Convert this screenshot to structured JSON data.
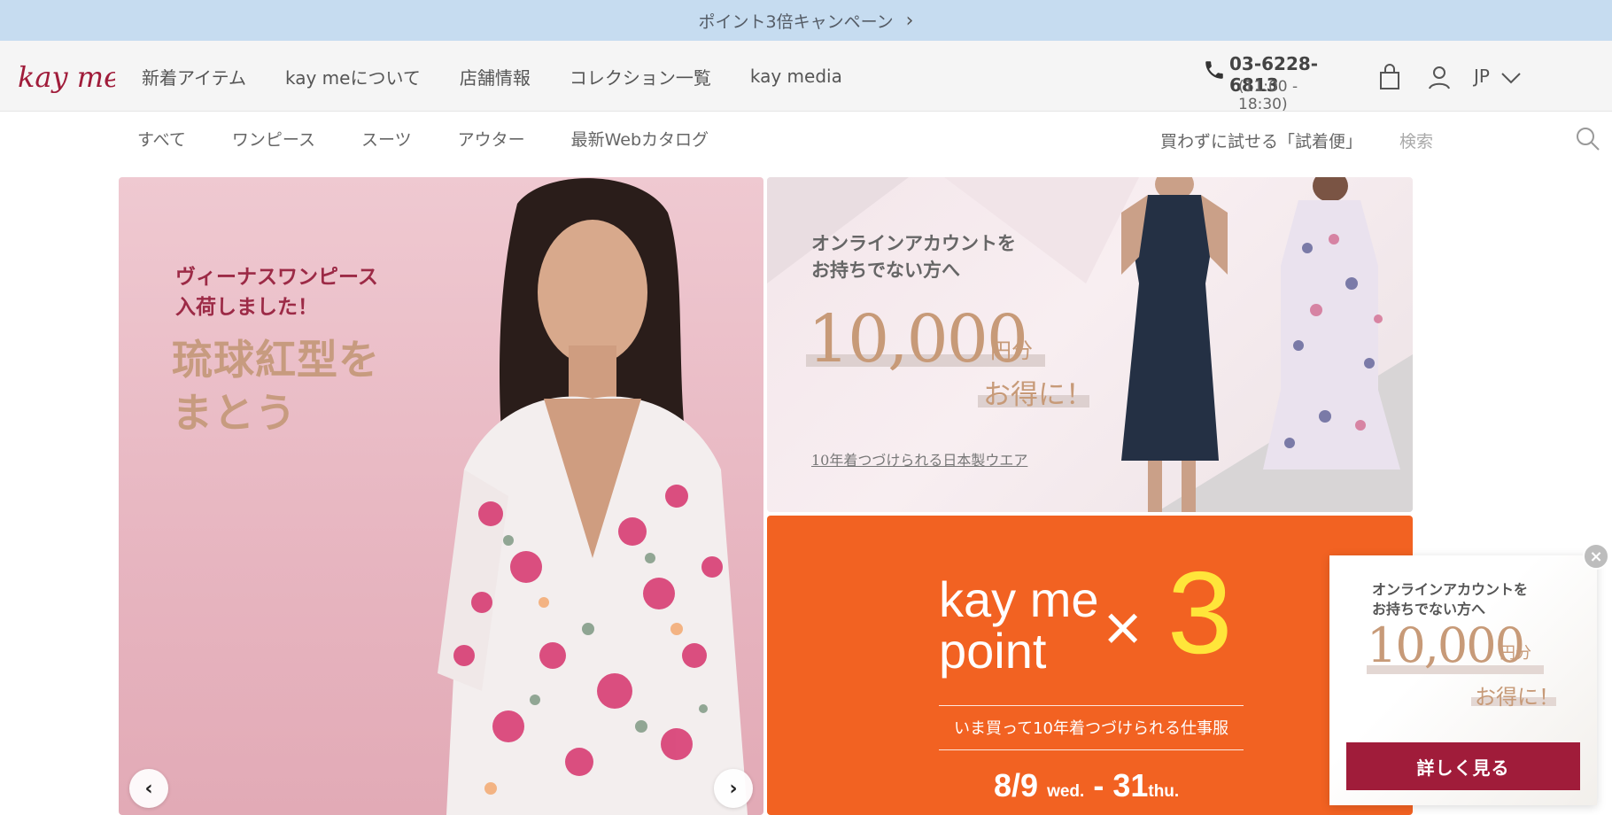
{
  "announcement": {
    "text": "ポイント3倍キャンペーン",
    "chevron": "›"
  },
  "header": {
    "logo_text": "kay me",
    "nav": [
      "新着アイテム",
      "kay meについて",
      "店舗情報",
      "コレクション一覧",
      "kay media"
    ],
    "phone": {
      "number": "03-6228-6813",
      "hours": "(11:00 - 18:30)",
      "icon": "phone-icon"
    },
    "language": "JP"
  },
  "categories": {
    "items": [
      "すべて",
      "ワンピース",
      "スーツ",
      "アウター",
      "最新Webカタログ"
    ],
    "trial_link": "買わずに試せる「試着便」",
    "search_placeholder": "検索"
  },
  "hero": {
    "subtitle_line1": "ヴィーナスワンピース",
    "subtitle_line2": "入荷しました！",
    "title_line1": "琉球紅型を",
    "title_line2": "まとう",
    "prev": "‹",
    "next": "›"
  },
  "banner_account": {
    "line1": "オンラインアカウントを",
    "line2": "お持ちでない方へ",
    "amount": "10,000",
    "unit": "円分",
    "benefit": "お得に！",
    "tagline": "10年着つづけられる日本製ウエア"
  },
  "banner_point": {
    "brand_line1": "kay me",
    "brand_line2": "point",
    "times": "×",
    "multiplier": "3",
    "subtitle": "いま買って10年着つづけられる仕事服",
    "date_start": "8/9",
    "day_start": "wed.",
    "dash": "-",
    "date_end": "31",
    "day_end": "thu."
  },
  "popup": {
    "line1": "オンラインアカウントを",
    "line2": "お持ちでない方へ",
    "amount": "10,000",
    "unit": "円分",
    "benefit": "お得に！",
    "cta": "詳しく見る",
    "close": "×"
  },
  "colors": {
    "announcement_bg": "#c6dcf0",
    "brand_red": "#a01c3a",
    "point_orange": "#f26222",
    "point_yellow": "#ffe53a",
    "gold_text": "#c79a78"
  }
}
